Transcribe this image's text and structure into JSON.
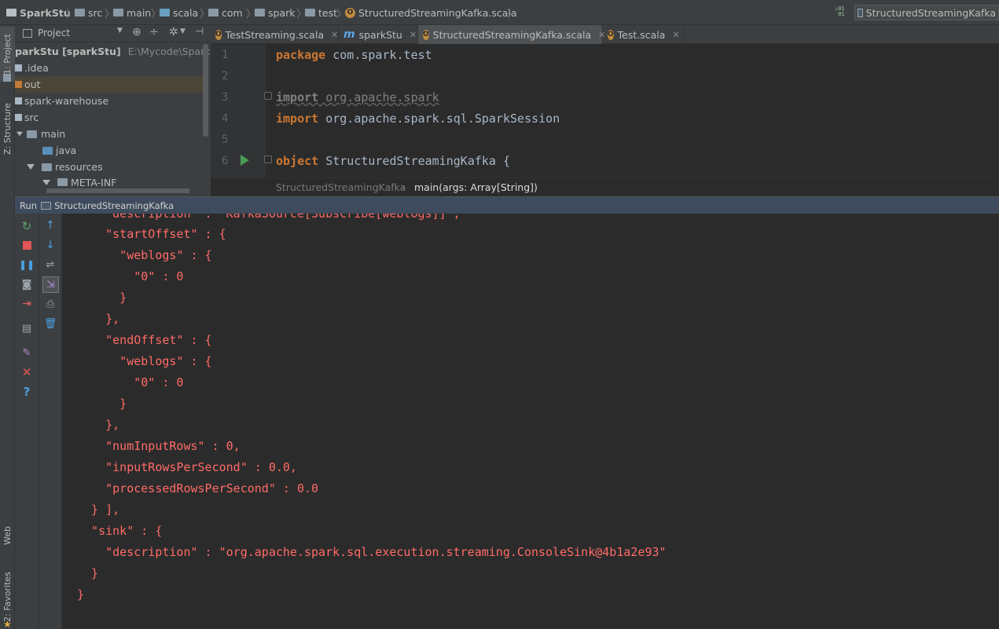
{
  "navbar": {
    "crumbs": [
      "SparkStu",
      "src",
      "main",
      "scala",
      "com",
      "spark",
      "test",
      "StructuredStreamingKafka.scala"
    ],
    "run_config": "StructuredStreamingKafka"
  },
  "left_stripe": {
    "project_tab": "1: Project",
    "structure_tab": "Z: Structure",
    "web_tab": "Web",
    "favorites_tab": "2: Favorites"
  },
  "project_panel": {
    "title": "Project",
    "root_name": "parkStu [sparkStu]",
    "root_path": "E:\\Mycode\\SparkStu",
    "items": [
      {
        "label": ".idea"
      },
      {
        "label": "out"
      },
      {
        "label": "spark-warehouse"
      },
      {
        "label": "src"
      },
      {
        "label": "main"
      },
      {
        "label": "java"
      },
      {
        "label": "resources"
      },
      {
        "label": "META-INF"
      }
    ]
  },
  "editor_tabs": [
    {
      "label": "TestStreaming.scala"
    },
    {
      "label": "sparkStu"
    },
    {
      "label": "StructuredStreamingKafka.scala"
    },
    {
      "label": "Test.scala"
    }
  ],
  "editor": {
    "line_numbers": [
      "1",
      "2",
      "3",
      "4",
      "5",
      "6"
    ],
    "line1_kw": "package",
    "line1_rest": " com.spark.test",
    "line3_kw": "import",
    "line3_rest": " org.apache.spark",
    "line4_kw": "import",
    "line4_rest": " org.apache.spark.sql.SparkSession",
    "line6_kw": "object",
    "line6_rest": " StructuredStreamingKafka {"
  },
  "editor_breadcrumb": {
    "object": "StructuredStreamingKafka",
    "method": "main(args: Array[String])"
  },
  "run_panel": {
    "label": "Run",
    "config": "StructuredStreamingKafka"
  },
  "console_lines": [
    "    \"description\" : \"KafkaSource[Subscribe[weblogs]]\",",
    "    \"startOffset\" : {",
    "      \"weblogs\" : {",
    "        \"0\" : 0",
    "      }",
    "    },",
    "    \"endOffset\" : {",
    "      \"weblogs\" : {",
    "        \"0\" : 0",
    "      }",
    "    },",
    "    \"numInputRows\" : 0,",
    "    \"inputRowsPerSecond\" : 0.0,",
    "    \"processedRowsPerSecond\" : 0.0",
    "  } ],",
    "  \"sink\" : {",
    "    \"description\" : \"org.apache.spark.sql.execution.streaming.ConsoleSink@4b1a2e93\"",
    "  }",
    "}"
  ]
}
